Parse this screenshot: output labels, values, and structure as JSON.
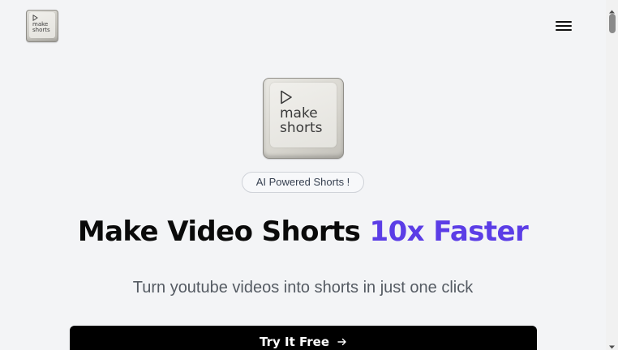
{
  "nav": {
    "logo_text": "make shorts",
    "logo_line1": "make",
    "logo_line2": "shorts",
    "menu_icon": "hamburger-menu-icon"
  },
  "hero": {
    "logo_line1": "make",
    "logo_line2": "shorts",
    "badge": "AI Powered Shorts !",
    "headline_main": "Make Video Shorts ",
    "headline_accent": "10x Faster",
    "subheadline": "Turn youtube videos into shorts in just one click",
    "cta_label": "Try It Free",
    "cta_icon": "arrow-right-icon"
  },
  "colors": {
    "background": "#f3f4f6",
    "accent": "#5b3de6",
    "cta_background": "#000000",
    "text": "#0a0a0a"
  }
}
